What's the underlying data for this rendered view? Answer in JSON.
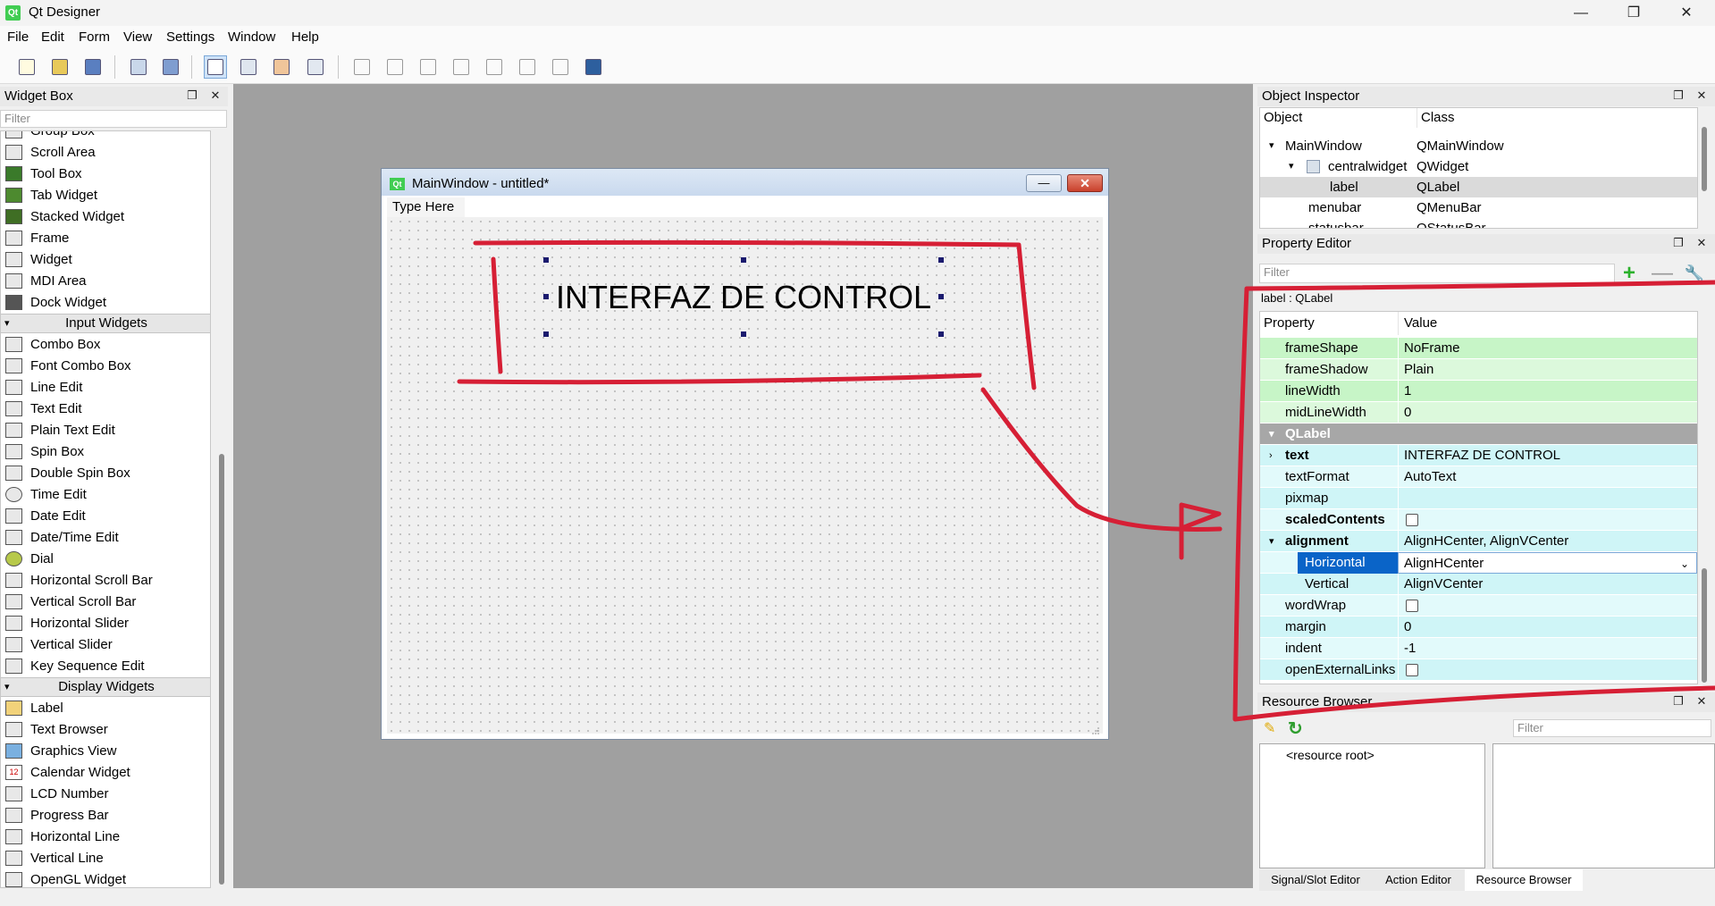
{
  "app": {
    "title": "Qt Designer",
    "icon_text": "Qt"
  },
  "window_controls": {
    "minimize": "—",
    "maximize": "❐",
    "close": "✕"
  },
  "menu": [
    "File",
    "Edit",
    "Form",
    "View",
    "Settings",
    "Window",
    "Help"
  ],
  "widget_box": {
    "title": "Widget Box",
    "filter_placeholder": "Filter",
    "clipped_item": "Group Box",
    "items_containers": [
      "Scroll Area",
      "Tool Box",
      "Tab Widget",
      "Stacked Widget",
      "Frame",
      "Widget",
      "MDI Area",
      "Dock Widget"
    ],
    "category_input": "Input Widgets",
    "items_input": [
      "Combo Box",
      "Font Combo Box",
      "Line Edit",
      "Text Edit",
      "Plain Text Edit",
      "Spin Box",
      "Double Spin Box",
      "Time Edit",
      "Date Edit",
      "Date/Time Edit",
      "Dial",
      "Horizontal Scroll Bar",
      "Vertical Scroll Bar",
      "Horizontal Slider",
      "Vertical Slider",
      "Key Sequence Edit"
    ],
    "category_display": "Display Widgets",
    "items_display": [
      "Label",
      "Text Browser",
      "Graphics View",
      "Calendar Widget",
      "LCD Number",
      "Progress Bar",
      "Horizontal Line",
      "Vertical Line",
      "OpenGL Widget"
    ]
  },
  "form": {
    "icon_text": "Qt",
    "title": "MainWindow - untitled*",
    "menu_placeholder": "Type Here",
    "label_text": "INTERFAZ DE CONTROL"
  },
  "object_inspector": {
    "title": "Object Inspector",
    "col_object": "Object",
    "col_class": "Class",
    "rows": [
      {
        "object": "MainWindow",
        "class": "QMainWindow"
      },
      {
        "object": "centralwidget",
        "class": "QWidget"
      },
      {
        "object": "label",
        "class": "QLabel"
      },
      {
        "object": "menubar",
        "class": "QMenuBar"
      },
      {
        "object": "statusbar",
        "class": "QStatusBar"
      }
    ]
  },
  "property_editor": {
    "title": "Property Editor",
    "filter_placeholder": "Filter",
    "object_label": "label : QLabel",
    "col_property": "Property",
    "col_value": "Value",
    "rows": [
      {
        "name": "frameShape",
        "value": "NoFrame"
      },
      {
        "name": "frameShadow",
        "value": "Plain"
      },
      {
        "name": "lineWidth",
        "value": "1"
      },
      {
        "name": "midLineWidth",
        "value": "0"
      },
      {
        "name": "QLabel",
        "value": ""
      },
      {
        "name": "text",
        "value": "INTERFAZ DE CONTROL"
      },
      {
        "name": "textFormat",
        "value": "AutoText"
      },
      {
        "name": "pixmap",
        "value": ""
      },
      {
        "name": "scaledContents",
        "value": ""
      },
      {
        "name": "alignment",
        "value": "AlignHCenter, AlignVCenter"
      },
      {
        "name": "Horizontal",
        "value": "AlignHCenter"
      },
      {
        "name": "Vertical",
        "value": "AlignVCenter"
      },
      {
        "name": "wordWrap",
        "value": ""
      },
      {
        "name": "margin",
        "value": "0"
      },
      {
        "name": "indent",
        "value": "-1"
      },
      {
        "name": "openExternalLinks",
        "value": ""
      }
    ]
  },
  "resource_browser": {
    "title": "Resource Browser",
    "filter_placeholder": "Filter",
    "root": "<resource root>"
  },
  "bottom_tabs": [
    "Signal/Slot Editor",
    "Action Editor",
    "Resource Browser"
  ],
  "colors": {
    "annotation": "#d61f35",
    "property_green": "#c7f5c7",
    "property_cyan": "#cff5f7",
    "selection_blue": "#0a64c8"
  }
}
